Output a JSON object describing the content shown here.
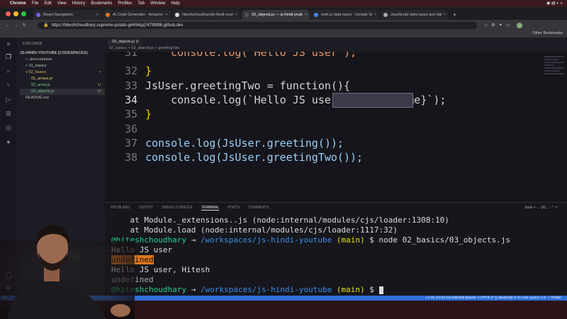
{
  "menubar": {
    "items": [
      "Chrome",
      "File",
      "Edit",
      "View",
      "History",
      "Bookmarks",
      "Profiles",
      "Tab",
      "Window",
      "Help"
    ]
  },
  "browser": {
    "tabs": [
      {
        "title": "React Navigation",
        "active": false
      },
      {
        "title": "AI Code Generator - Amazon C",
        "active": false
      },
      {
        "title": "hiteshchoudhary/js-hindi-youtu",
        "active": false
      },
      {
        "title": "03_objects.js — js-hindi-youtu",
        "active": true
      },
      {
        "title": "mdn js data types - Google Se",
        "active": false
      },
      {
        "title": "JavaScript data types and data",
        "active": false
      }
    ],
    "new_tab": "+",
    "url": "https://hiteshchoudhary-supreme-potato-g4454qq7479fd96.github.dev",
    "bookmarks_label": "Other Bookmarks"
  },
  "explorer": {
    "title": "EXPLORER",
    "root": "JS-HINDI-YOUTUBE [CODESPACES]",
    "items": [
      {
        "label": "> .devcontainer",
        "indent": 1,
        "badge": "",
        "selected": false
      },
      {
        "label": "> 01_basics",
        "indent": 1,
        "badge": "",
        "selected": false
      },
      {
        "label": "v 02_basics",
        "indent": 1,
        "badge": "•",
        "selected": false
      },
      {
        "label": "01_arrays.js",
        "indent": 2,
        "badge": "",
        "selected": false
      },
      {
        "label": "02_array.js",
        "indent": 2,
        "badge": "U",
        "selected": false
      },
      {
        "label": "03_objects.js",
        "indent": 2,
        "badge": "U",
        "selected": true
      },
      {
        "label": "README.md",
        "indent": 1,
        "badge": "",
        "selected": false
      }
    ]
  },
  "editor": {
    "tab": "03_objects.js U",
    "breadcrumb": "02_basics > 03_objects.js > greetingTwo",
    "lines": [
      {
        "num": "31",
        "text": "    console.log(`Hello JS user`);"
      },
      {
        "num": "32",
        "text": "}"
      },
      {
        "num": "33",
        "text": "JsUser.greetingTwo = function(){"
      },
      {
        "num": "34",
        "text": "    console.log(`Hello JS user, ${this.name}`);"
      },
      {
        "num": "35",
        "text": "}"
      },
      {
        "num": "36",
        "text": ""
      },
      {
        "num": "37",
        "text": "console.log(JsUser.greeting());"
      },
      {
        "num": "38",
        "text": "console.log(JsUser.greetingTwo());"
      }
    ]
  },
  "panel": {
    "tabs": [
      "PROBLEMS",
      "OUTPUT",
      "DEBUG CONSOLE",
      "TERMINAL",
      "PORTS",
      "COMMENTS"
    ],
    "active_tab": "TERMINAL",
    "shell": "bash",
    "lines": [
      "    at Module._extensions..js (node:internal/modules/cjs/loader:1308:10)",
      "    at Module.load (node:internal/modules/cjs/loader:1117:32)",
      "Hello JS user",
      "undefined",
      "Hello JS user, Hitesh",
      "undefined"
    ],
    "prompt_user": "@hiteshchoudhary",
    "prompt_arrow": "→",
    "prompt_path": "/workspaces/js-hindi-youtube",
    "prompt_branch": "(main)",
    "prompt_cmd": "$ node 02_basics/03_objects.js",
    "prompt_end": "$"
  },
  "statusbar": {
    "left": "Co",
    "right": "Ln 34, Col 33 (13 selected)   Spaces: 4   UTF-8   LF   {} JavaScript   ⊙ Go Live   Layout: U.S.   ✓ Prettier"
  }
}
